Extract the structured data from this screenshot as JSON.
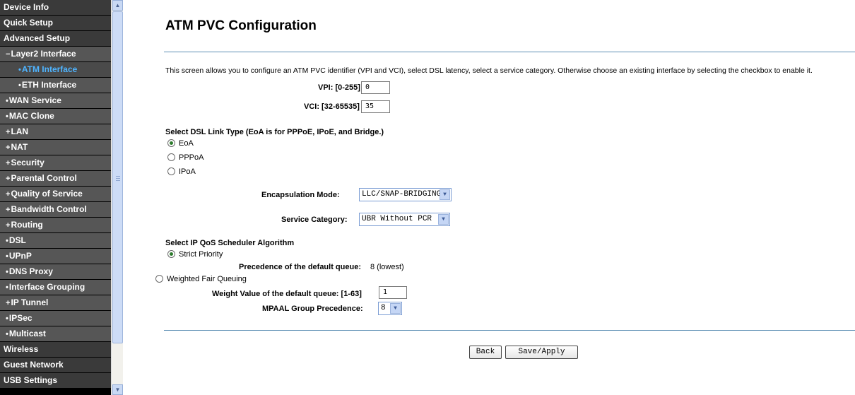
{
  "sidebar": {
    "items": [
      {
        "label": "Device Info",
        "bullet": "",
        "level": 0,
        "active": false
      },
      {
        "label": "Quick Setup",
        "bullet": "",
        "level": 0,
        "active": false
      },
      {
        "label": "Advanced Setup",
        "bullet": "",
        "level": 0,
        "active": false
      },
      {
        "label": "Layer2 Interface",
        "bullet": "−",
        "level": 1,
        "active": false
      },
      {
        "label": "ATM Interface",
        "bullet": "•",
        "level": 2,
        "active": true
      },
      {
        "label": "ETH Interface",
        "bullet": "•",
        "level": 2,
        "active": false
      },
      {
        "label": "WAN Service",
        "bullet": "•",
        "level": 1,
        "active": false
      },
      {
        "label": "MAC Clone",
        "bullet": "•",
        "level": 1,
        "active": false
      },
      {
        "label": "LAN",
        "bullet": "+",
        "level": 1,
        "active": false
      },
      {
        "label": "NAT",
        "bullet": "+",
        "level": 1,
        "active": false
      },
      {
        "label": "Security",
        "bullet": "+",
        "level": 1,
        "active": false
      },
      {
        "label": "Parental Control",
        "bullet": "+",
        "level": 1,
        "active": false
      },
      {
        "label": "Quality of Service",
        "bullet": "+",
        "level": 1,
        "active": false
      },
      {
        "label": "Bandwidth Control",
        "bullet": "+",
        "level": 1,
        "active": false
      },
      {
        "label": "Routing",
        "bullet": "+",
        "level": 1,
        "active": false
      },
      {
        "label": "DSL",
        "bullet": "•",
        "level": 1,
        "active": false
      },
      {
        "label": "UPnP",
        "bullet": "•",
        "level": 1,
        "active": false
      },
      {
        "label": "DNS Proxy",
        "bullet": "•",
        "level": 1,
        "active": false
      },
      {
        "label": "Interface Grouping",
        "bullet": "•",
        "level": 1,
        "active": false
      },
      {
        "label": "IP Tunnel",
        "bullet": "+",
        "level": 1,
        "active": false
      },
      {
        "label": "IPSec",
        "bullet": "•",
        "level": 1,
        "active": false
      },
      {
        "label": "Multicast",
        "bullet": "•",
        "level": 1,
        "active": false
      },
      {
        "label": "Wireless",
        "bullet": "",
        "level": 0,
        "active": false
      },
      {
        "label": "Guest Network",
        "bullet": "",
        "level": 0,
        "active": false
      },
      {
        "label": "USB Settings",
        "bullet": "",
        "level": 0,
        "active": false
      }
    ]
  },
  "scrollbar": {
    "up": "▲",
    "down": "▼"
  },
  "page": {
    "title": "ATM PVC Configuration",
    "description": "This screen allows you to configure an ATM PVC identifier (VPI and VCI), select DSL latency, select a service category. Otherwise choose an existing interface by selecting the checkbox to enable it.",
    "vpi_label": "VPI: [0-255]",
    "vpi_value": "0",
    "vci_label": "VCI: [32-65535]",
    "vci_value": "35",
    "link_type_heading": "Select DSL Link Type (EoA is for PPPoE, IPoE, and Bridge.)",
    "link_types": [
      {
        "label": "EoA",
        "checked": true
      },
      {
        "label": "PPPoA",
        "checked": false
      },
      {
        "label": "IPoA",
        "checked": false
      }
    ],
    "encap_label": "Encapsulation Mode:",
    "encap_value": "LLC/SNAP-BRIDGING",
    "service_label": "Service Category:",
    "service_value": "UBR Without PCR",
    "qos_heading": "Select IP QoS Scheduler Algorithm",
    "strict_priority_label": "Strict Priority",
    "precedence_label": "Precedence of the default queue:",
    "precedence_value": "8 (lowest)",
    "wfq_label": "Weighted Fair Queuing",
    "weight_label": "Weight Value of the default queue: [1-63]",
    "weight_value": "1",
    "mpaal_label": "MPAAL Group Precedence:",
    "mpaal_value": "8",
    "dropdown_arrow": "▼",
    "back_label": "Back",
    "save_label": "Save/Apply"
  }
}
